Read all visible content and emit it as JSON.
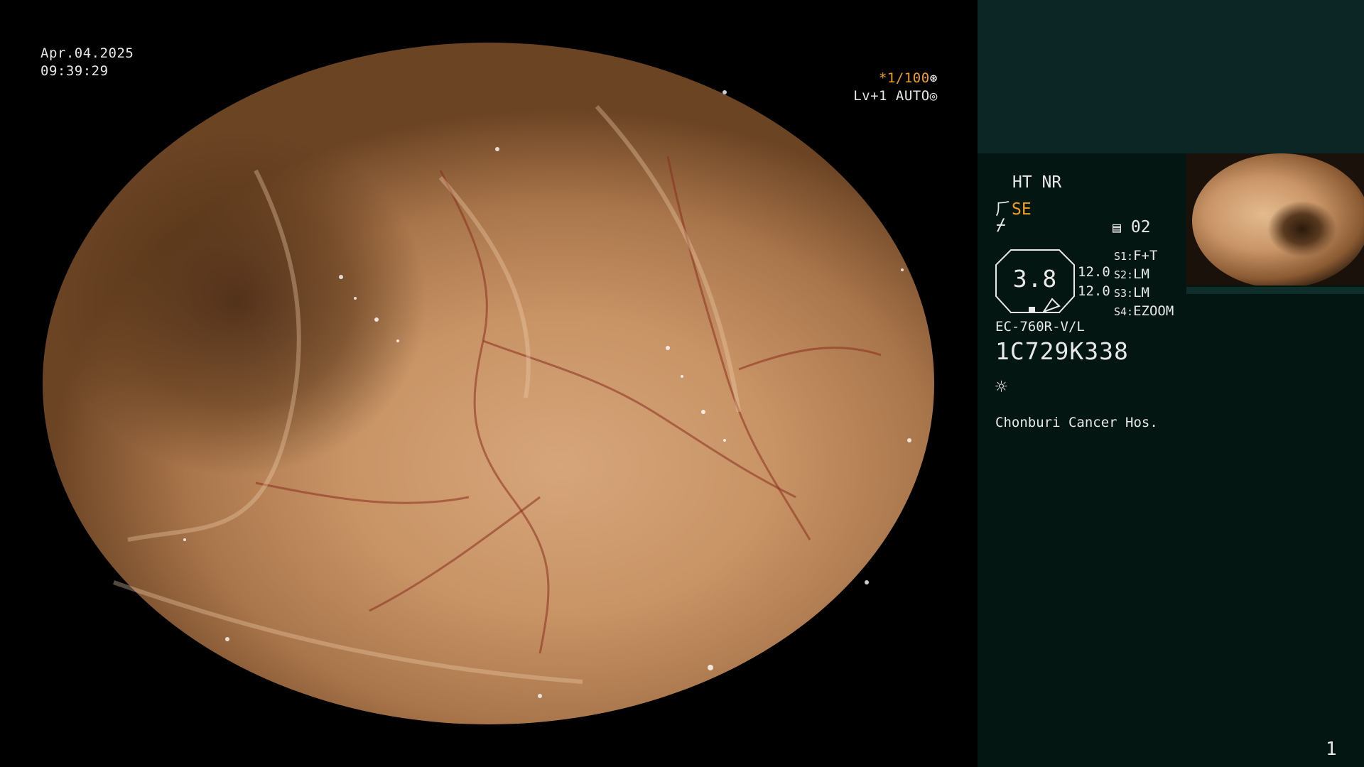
{
  "overlay": {
    "date": "Apr.04.2025",
    "time": "09:39:29",
    "shutter": "*1/100",
    "level": "Lv+1 AUTO"
  },
  "panel": {
    "mode": "HT NR",
    "se": "SE",
    "preset": "02",
    "zoom": "3.8",
    "val_a": "12.0",
    "val_b": "12.0",
    "switches": [
      {
        "key": "S1:",
        "val": "F+T"
      },
      {
        "key": "S2:",
        "val": "LM"
      },
      {
        "key": "S3:",
        "val": "LM"
      },
      {
        "key": "S4:",
        "val": "EZOOM"
      }
    ],
    "scope_model": "EC-760R-V/L",
    "serial": "1C729K338",
    "hospital": "Chonburi Cancer Hos.",
    "page_number": "1"
  },
  "colors": {
    "accent": "#f0a020",
    "panel_bg": "#041612",
    "panel_top": "#0c2626"
  },
  "icons": [
    "aperture-icon",
    "iris-icon",
    "fork-icon",
    "signal-icon",
    "document-icon",
    "brightness-icon"
  ]
}
